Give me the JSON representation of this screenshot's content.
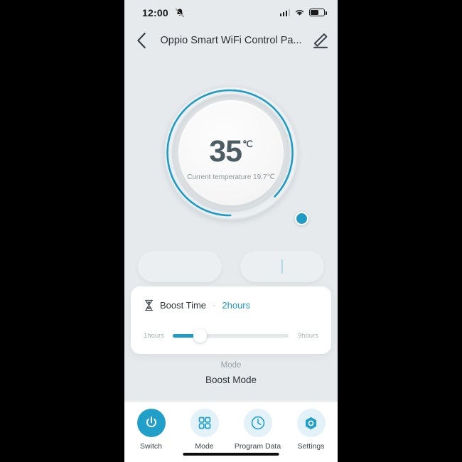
{
  "status_bar": {
    "time": "12:00",
    "mute_icon": "bell-muted-icon",
    "signal_icon": "cellular-signal-icon",
    "wifi_icon": "wifi-icon",
    "battery_icon": "battery-icon"
  },
  "header": {
    "back_icon": "chevron-left-icon",
    "title": "Oppio Smart WiFi Control Pa...",
    "edit_icon": "pencil-edit-icon"
  },
  "dial": {
    "target_temperature": "35",
    "unit": "℃",
    "current_temperature_text": "Current temperature 19.7℃",
    "arc_color": "#1e9cc6",
    "track_color": "#dfe3e6",
    "knob_name": "dial-knob"
  },
  "adjust": {
    "decrease_label": "−",
    "increase_label": "+",
    "glyph_color": "#a9d7e8"
  },
  "boost_card": {
    "icon": "hourglass-icon",
    "label": "Boost Time",
    "separator": "·",
    "value": "2hours",
    "value_color": "#1e9cc6",
    "slider": {
      "min_label": "1hours",
      "max_label": "9hours",
      "fill_color": "#1e9cc6"
    }
  },
  "mode": {
    "label": "Mode",
    "value": "Boost Mode"
  },
  "bottom_nav": {
    "items": [
      {
        "label": "Switch",
        "icon": "power-icon",
        "active": true
      },
      {
        "label": "Mode",
        "icon": "grid-icon",
        "active": false
      },
      {
        "label": "Program Data",
        "icon": "clock-icon",
        "active": false
      },
      {
        "label": "Settings",
        "icon": "hexagon-gear-icon",
        "active": false
      }
    ],
    "active_color": "#20a0c8",
    "inactive_bg": "#e2f2f8"
  }
}
